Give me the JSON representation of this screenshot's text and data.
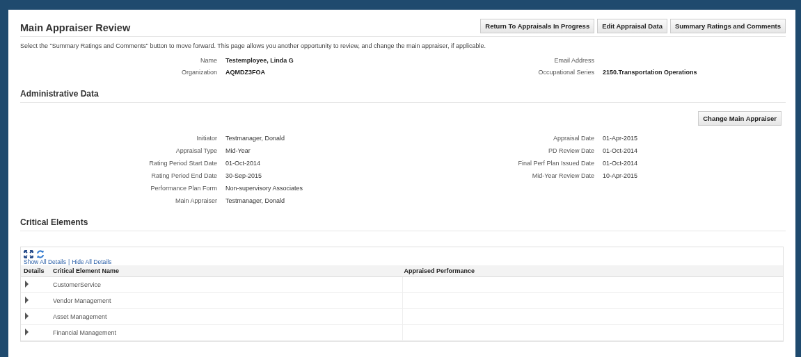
{
  "page": {
    "title": "Main Appraiser Review",
    "buttons": [
      "Return To Appraisals In Progress",
      "Edit Appraisal Data",
      "Summary Ratings and Comments"
    ],
    "instruction": "Select the \"Summary Ratings and Comments\" button to move forward. This page allows you another opportunity to review, and change the main appraiser, if applicable."
  },
  "employee": {
    "left": [
      {
        "label": "Name",
        "value": "Testemployee, Linda G"
      },
      {
        "label": "Organization",
        "value": "AQMDZ3FOA"
      }
    ],
    "right": [
      {
        "label": "Email Address"
      },
      {
        "label": "Occupational Series",
        "value": "2150.Transportation Operations"
      }
    ]
  },
  "administrative_data": {
    "title": "Administrative Data",
    "button": "Change Main Appraiser",
    "left": [
      {
        "label": "Initiator",
        "value": "Testmanager, Donald"
      },
      {
        "label": "Appraisal Type",
        "value": "Mid-Year"
      },
      {
        "label": "Rating Period Start Date",
        "value": "01-Oct-2014"
      },
      {
        "label": "Rating Period End Date",
        "value": "30-Sep-2015"
      },
      {
        "label": "Performance Plan Form",
        "value": "Non-supervisory Associates"
      },
      {
        "label": "Main Appraiser",
        "value": "Testmanager, Donald"
      }
    ],
    "right": [
      {
        "label": "Appraisal Date",
        "value": "01-Apr-2015"
      },
      {
        "label": "PD Review Date",
        "value": "01-Oct-2014"
      },
      {
        "label": "Final Perf Plan Issued Date",
        "value": "01-Oct-2014"
      },
      {
        "label": "Mid-Year Review Date",
        "value": "10-Apr-2015"
      }
    ]
  },
  "critical_elements": {
    "title": "Critical Elements",
    "links": [
      "Show All Details",
      "Hide All Details"
    ],
    "separator": "|",
    "columns": [
      "Details",
      "Critical Element Name",
      "Appraised Performance"
    ],
    "rows": [
      {
        "name": "CustomerService",
        "expanded": false
      },
      {
        "name": "Vendor Management",
        "expanded": false
      },
      {
        "name": "Asset Management",
        "expanded": false
      },
      {
        "name": "Financial Management",
        "expanded": false
      }
    ]
  }
}
